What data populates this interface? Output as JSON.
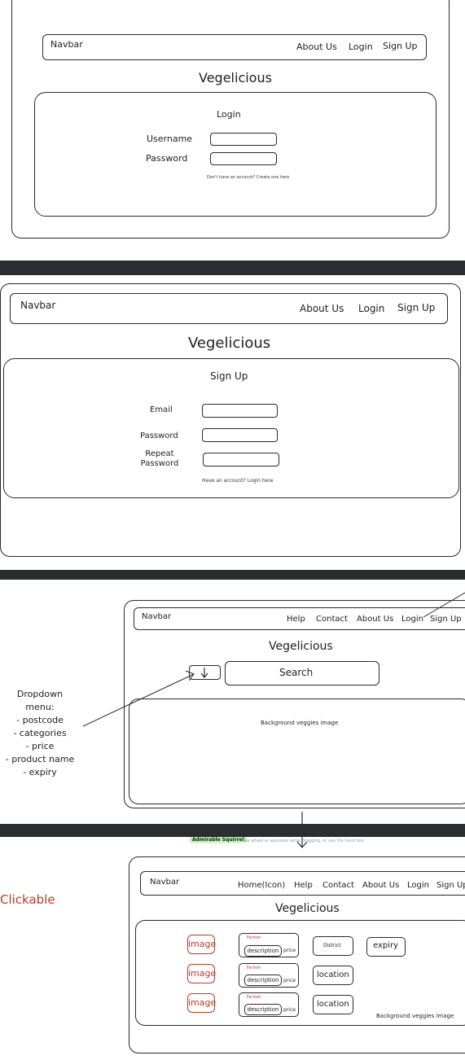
{
  "colors": {
    "band": "#2b2d31",
    "stroke": "#2a2a2a",
    "accent_red": "#c0392b",
    "badge_green": "#b9f3b2"
  },
  "login_screen": {
    "navbar_label": "Navbar",
    "nav_links": [
      "About Us",
      "Login",
      "Sign Up"
    ],
    "brand": "Vegelicious",
    "card_title": "Login",
    "username_label": "Username",
    "password_label": "Password",
    "footer_link": "Don't have an account? Create one here"
  },
  "signup_screen": {
    "navbar_label": "Navbar",
    "nav_links": [
      "About Us",
      "Login",
      "Sign Up"
    ],
    "brand": "Vegelicious",
    "card_title": "Sign Up",
    "email_label": "Email",
    "password_label": "Password",
    "repeat_password_label": "Repeat\nPassword",
    "footer_link": "Have an account? Login here"
  },
  "search_screen": {
    "navbar_label": "Navbar",
    "nav_links": [
      "Help",
      "Contact",
      "About Us",
      "Login",
      "Sign Up"
    ],
    "brand": "Vegelicious",
    "dropdown_icon": "arrow-down-icon",
    "search_label": "Search",
    "background_text": "Background veggies image",
    "annotation": "Dropdown\nmenu:\n- postcode\n- categories\n- price\n- product name\n- expiry"
  },
  "toolbar_hint": {
    "badge": "Admirable Squirrel",
    "text": "use wheel or spacebar while dragging, or use the hand tool"
  },
  "results_screen": {
    "navbar_label": "Navbar",
    "nav_links": [
      "Home(Icon)",
      "Help",
      "Contact",
      "About Us",
      "Login",
      "Sign Up"
    ],
    "brand": "Vegelicious",
    "side_note": "Clickable",
    "rows": [
      {
        "image": "image",
        "farmer": "Farmer",
        "description": "description",
        "price": "price",
        "meta": "District",
        "extra": "expiry"
      },
      {
        "image": "image",
        "farmer": "Farmer",
        "description": "description",
        "price": "price",
        "meta": "location",
        "extra": ""
      },
      {
        "image": "image",
        "farmer": "Farmer",
        "description": "description",
        "price": "price",
        "meta": "location",
        "extra": ""
      }
    ],
    "background_text": "Background veggies image"
  }
}
